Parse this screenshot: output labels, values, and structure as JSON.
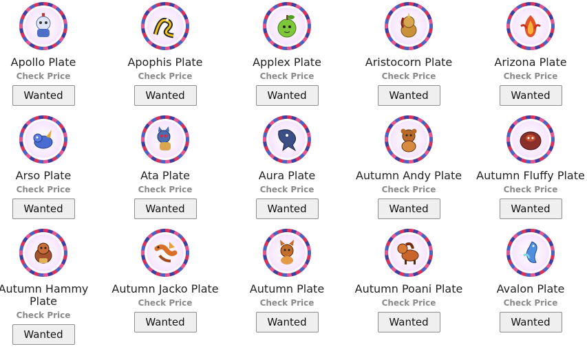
{
  "items": [
    {
      "name": "Apollo Plate",
      "price_label": "Check Price",
      "button": "Wanted",
      "pet_icon": "robot-pet-icon",
      "color": "#e0e6f5"
    },
    {
      "name": "Apophis Plate",
      "price_label": "Check Price",
      "button": "Wanted",
      "pet_icon": "snake-pet-icon",
      "color": "#f2c21e"
    },
    {
      "name": "Applex Plate",
      "price_label": "Check Price",
      "button": "Wanted",
      "pet_icon": "apple-pet-icon",
      "color": "#7ec63a"
    },
    {
      "name": "Aristocorn Plate",
      "price_label": "Check Price",
      "button": "Wanted",
      "pet_icon": "unicorn-pet-icon",
      "color": "#c9923a"
    },
    {
      "name": "Arizona Plate",
      "price_label": "Check Price",
      "button": "Wanted",
      "pet_icon": "fire-bird-pet-icon",
      "color": "#e2532a"
    },
    {
      "name": "Arso Plate",
      "price_label": "Check Price",
      "button": "Wanted",
      "pet_icon": "dragon-pet-icon",
      "color": "#4a6bd0"
    },
    {
      "name": "Ata Plate",
      "price_label": "Check Price",
      "button": "Wanted",
      "pet_icon": "cat-pet-icon",
      "color": "#4b6db0"
    },
    {
      "name": "Aura Plate",
      "price_label": "Check Price",
      "button": "Wanted",
      "pet_icon": "wraith-pet-icon",
      "color": "#3b4f86"
    },
    {
      "name": "Autumn Andy Plate",
      "price_label": "Check Price",
      "button": "Wanted",
      "pet_icon": "bear-pet-icon",
      "color": "#b9692a"
    },
    {
      "name": "Autumn Fluffy Plate",
      "price_label": "Check Price",
      "button": "Wanted",
      "pet_icon": "fluffy-pet-icon",
      "color": "#8a2f2a"
    },
    {
      "name": "Autumn Hammy Plate",
      "price_label": "Check Price",
      "button": "Wanted",
      "pet_icon": "hamster-pet-icon",
      "color": "#a2522c"
    },
    {
      "name": "Autumn Jacko Plate",
      "price_label": "Check Price",
      "button": "Wanted",
      "pet_icon": "lizard-pet-icon",
      "color": "#d9702a"
    },
    {
      "name": "Autumn Plate",
      "price_label": "Check Price",
      "button": "Wanted",
      "pet_icon": "fox-pet-icon",
      "color": "#c36d2b"
    },
    {
      "name": "Autumn Poani Plate",
      "price_label": "Check Price",
      "button": "Wanted",
      "pet_icon": "pony-pet-icon",
      "color": "#c9652b"
    },
    {
      "name": "Avalon Plate",
      "price_label": "Check Price",
      "button": "Wanted",
      "pet_icon": "seahorse-pet-icon",
      "color": "#4f8fe0"
    }
  ]
}
